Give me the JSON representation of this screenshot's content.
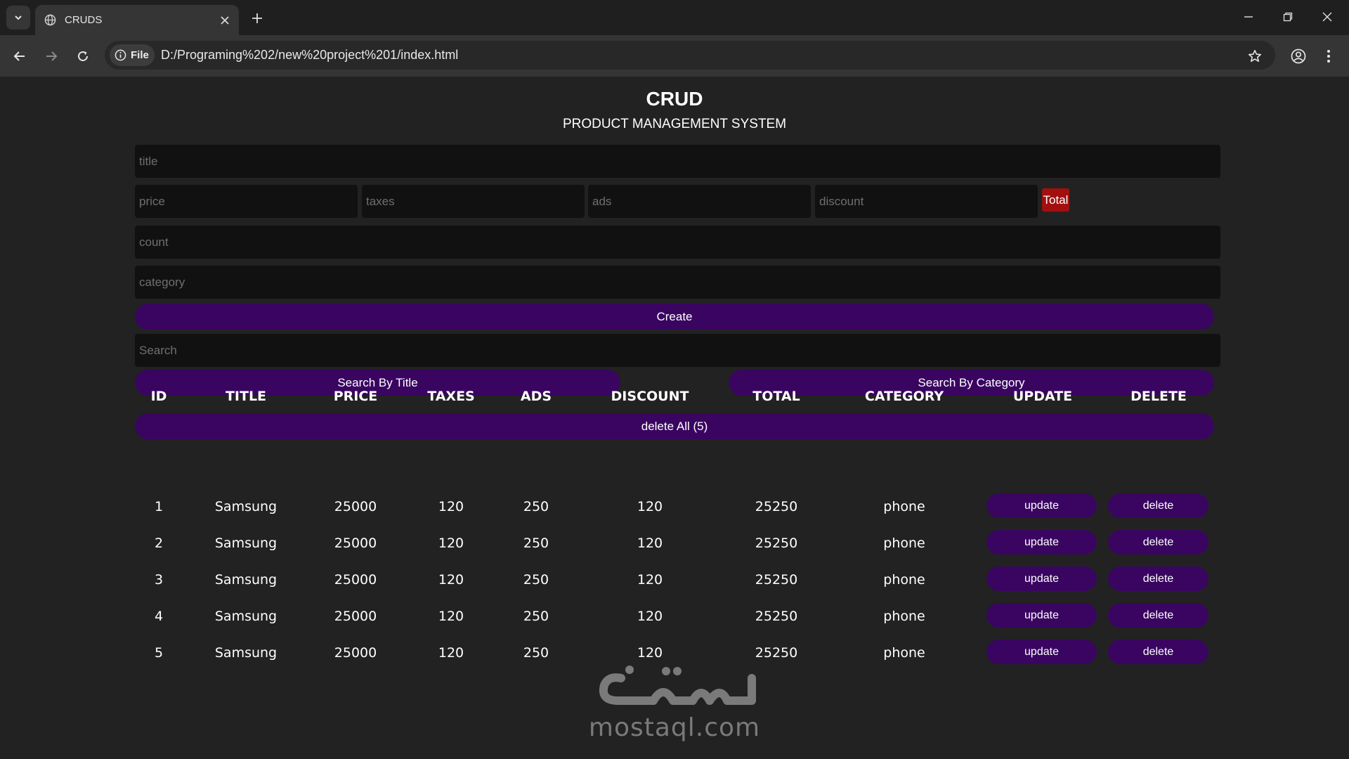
{
  "browser": {
    "tab_title": "CRUDS",
    "site_chip_label": "File",
    "url": "D:/Programing%202/new%20project%201/index.html"
  },
  "app": {
    "title": "CRUD",
    "subtitle": "PRODUCT MANAGEMENT SYSTEM"
  },
  "form": {
    "title_placeholder": "title",
    "price_placeholder": "price",
    "taxes_placeholder": "taxes",
    "ads_placeholder": "ads",
    "discount_placeholder": "discount",
    "total_label": "Total",
    "count_placeholder": "count",
    "category_placeholder": "category",
    "create_label": "Create",
    "search_placeholder": "Search",
    "search_by_title_label": "Search By Title",
    "search_by_category_label": "Search By Category",
    "delete_all_label": "delete All (5)"
  },
  "table": {
    "headers": [
      "ID",
      "TITLE",
      "PRICE",
      "TAXES",
      "ADS",
      "DISCOUNT",
      "TOTAL",
      "CATEGORY",
      "UPDATE",
      "DELETE"
    ],
    "rows": [
      {
        "id": "1",
        "title": "Samsung",
        "price": "25000",
        "taxes": "120",
        "ads": "250",
        "discount": "120",
        "total": "25250",
        "category": "phone",
        "update": "update",
        "delete": "delete"
      },
      {
        "id": "2",
        "title": "Samsung",
        "price": "25000",
        "taxes": "120",
        "ads": "250",
        "discount": "120",
        "total": "25250",
        "category": "phone",
        "update": "update",
        "delete": "delete"
      },
      {
        "id": "3",
        "title": "Samsung",
        "price": "25000",
        "taxes": "120",
        "ads": "250",
        "discount": "120",
        "total": "25250",
        "category": "phone",
        "update": "update",
        "delete": "delete"
      },
      {
        "id": "4",
        "title": "Samsung",
        "price": "25000",
        "taxes": "120",
        "ads": "250",
        "discount": "120",
        "total": "25250",
        "category": "phone",
        "update": "update",
        "delete": "delete"
      },
      {
        "id": "5",
        "title": "Samsung",
        "price": "25000",
        "taxes": "120",
        "ads": "250",
        "discount": "120",
        "total": "25250",
        "category": "phone",
        "update": "update",
        "delete": "delete"
      }
    ]
  },
  "watermark": {
    "text": "mostaql.com"
  },
  "colors": {
    "page_bg": "#222222",
    "button_purple": "#3a0561",
    "total_red": "#a30f0f",
    "input_bg": "#111111"
  },
  "icons": [
    "tab-search-icon",
    "globe-icon",
    "close-icon",
    "plus-icon",
    "minimize-icon",
    "restore-icon",
    "back-arrow-icon",
    "forward-arrow-icon",
    "reload-icon",
    "info-icon",
    "star-icon",
    "profile-icon",
    "kebab-menu-icon"
  ]
}
